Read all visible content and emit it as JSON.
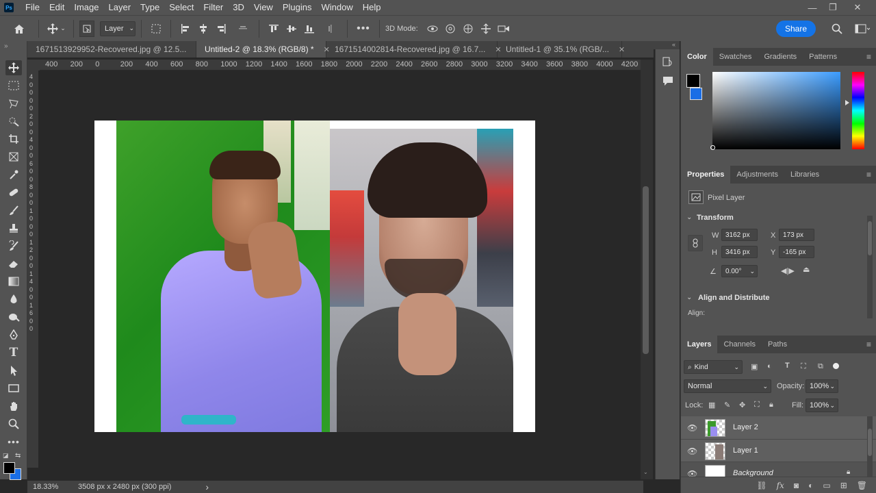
{
  "menu": [
    "File",
    "Edit",
    "Image",
    "Layer",
    "Type",
    "Select",
    "Filter",
    "3D",
    "View",
    "Plugins",
    "Window",
    "Help"
  ],
  "window_controls": {
    "minimize": "—",
    "restore": "❐",
    "close": "✕"
  },
  "options": {
    "auto_select_value": "Layer",
    "mode_3d_label": "3D Mode:",
    "share_label": "Share"
  },
  "tabs": [
    {
      "label": "1671513929952-Recovered.jpg @ 12.5...",
      "active": false
    },
    {
      "label": "Untitled-2 @ 18.3% (RGB/8) *",
      "active": true
    },
    {
      "label": "1671514002814-Recovered.jpg @ 16.7...",
      "active": false
    },
    {
      "label": "Untitled-1 @ 35.1% (RGB/...",
      "active": false
    }
  ],
  "ruler_h": [
    "400",
    "200",
    "0",
    "200",
    "400",
    "600",
    "800",
    "1000",
    "1200",
    "1400",
    "1600",
    "1800",
    "2000",
    "2200",
    "2400",
    "2600",
    "2800",
    "3000",
    "3200",
    "3400",
    "3600",
    "3800",
    "4000",
    "4200"
  ],
  "ruler_v": [
    "4",
    "0",
    "0",
    "0",
    "0",
    "2",
    "0",
    "0",
    "4",
    "0",
    "0",
    "6",
    "0",
    "0",
    "8",
    "0",
    "0",
    "1",
    "0",
    "0",
    "0",
    "1",
    "2",
    "0",
    "0",
    "1",
    "4",
    "0",
    "0",
    "1",
    "6",
    "0",
    "0"
  ],
  "status": {
    "zoom": "18.33%",
    "doc_info": "3508 px x 2480 px (300 ppi)",
    "arrow": "›"
  },
  "color_panel": {
    "tabs": [
      "Color",
      "Swatches",
      "Gradients",
      "Patterns"
    ],
    "foreground": "#000000",
    "background": "#1a6ee6"
  },
  "properties": {
    "tabs": [
      "Properties",
      "Adjustments",
      "Libraries"
    ],
    "layer_type": "Pixel Layer",
    "transform_title": "Transform",
    "w_label": "W",
    "w_value": "3162 px",
    "x_label": "X",
    "x_value": "173 px",
    "h_label": "H",
    "h_value": "3416 px",
    "y_label": "Y",
    "y_value": "-165 px",
    "angle_value": "0.00°",
    "align_title": "Align and Distribute",
    "align_label": "Align:"
  },
  "layers_panel": {
    "tabs": [
      "Layers",
      "Channels",
      "Paths"
    ],
    "filter_kind": "Kind",
    "blend_mode": "Normal",
    "opacity_label": "Opacity:",
    "opacity_value": "100%",
    "lock_label": "Lock:",
    "fill_label": "Fill:",
    "fill_value": "100%",
    "layers": [
      {
        "name": "Layer 2",
        "selected": true
      },
      {
        "name": "Layer 1",
        "selected": true
      },
      {
        "name": "Background",
        "selected": false
      }
    ]
  }
}
